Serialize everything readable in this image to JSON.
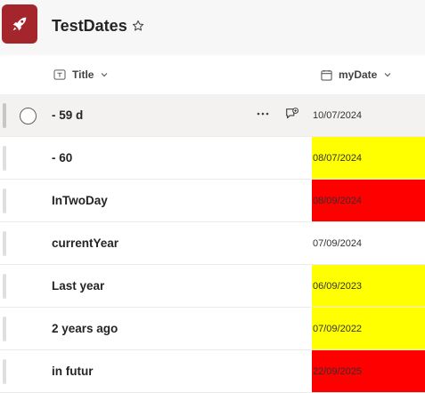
{
  "header": {
    "title": "TestDates",
    "app_icon": "rocket-icon",
    "favorite_icon": "star-icon"
  },
  "columns": {
    "title": {
      "label": "Title",
      "icon": "text-field-icon"
    },
    "date": {
      "label": "myDate",
      "icon": "calendar-icon"
    }
  },
  "colors": {
    "yellow": "#ffff00",
    "red": "#ff0000",
    "brand": "#a4262c"
  },
  "rows": [
    {
      "title": "- 59 d",
      "date": "10/07/2024",
      "highlight": "none",
      "selected": true
    },
    {
      "title": "- 60",
      "date": "08/07/2024",
      "highlight": "yellow"
    },
    {
      "title": "InTwoDay",
      "date": "08/09/2024",
      "highlight": "red"
    },
    {
      "title": "currentYear",
      "date": "07/09/2024",
      "highlight": "none"
    },
    {
      "title": "Last year",
      "date": "06/09/2023",
      "highlight": "yellow"
    },
    {
      "title": "2 years ago",
      "date": "07/09/2022",
      "highlight": "yellow"
    },
    {
      "title": "in futur",
      "date": "22/09/2025",
      "highlight": "red"
    }
  ]
}
